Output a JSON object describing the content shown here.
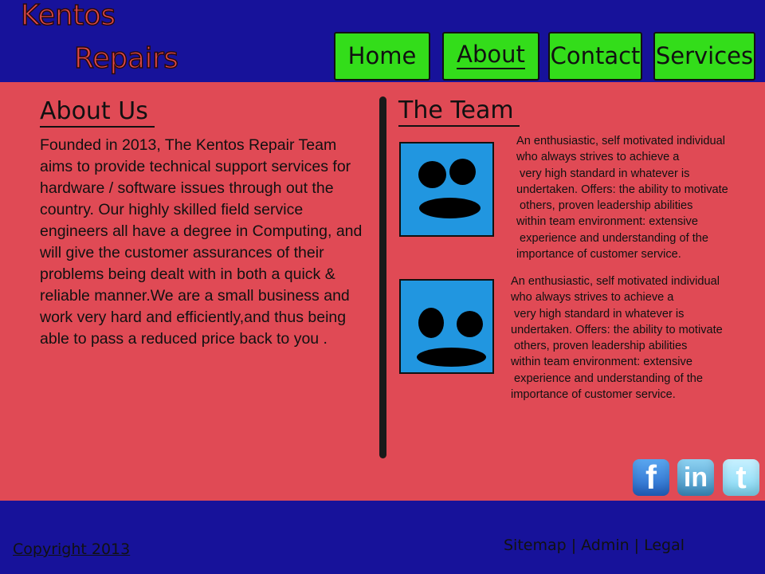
{
  "logo": {
    "line1": "Kentos",
    "line2": "Repairs"
  },
  "nav": [
    {
      "label": "Home",
      "active": false
    },
    {
      "label": "About",
      "active": true
    },
    {
      "label": "Contact",
      "active": false
    },
    {
      "label": "Services",
      "active": false
    }
  ],
  "about": {
    "title": "About Us",
    "text": "Founded in 2013, The Kentos Repair Team aims to provide technical support services for hardware / software issues through out the country. Our highly skilled field service engineers all have a degree in Computing, and will give the customer assurances of their problems being dealt with in both a quick & reliable manner.We are a small business and work very hard and efficiently,and thus being able to pass a reduced price back to you ."
  },
  "team": {
    "title": "The Team",
    "members": [
      {
        "bio": "An enthusiastic, self motivated individual\nwho always strives to achieve a\n very high standard in whatever is\nundertaken. Offers: the ability to motivate\n others, proven leadership abilities\nwithin team environment: extensive\n experience and understanding of the\nimportance of customer service."
      },
      {
        "bio": "An enthusiastic, self motivated individual\nwho always strives to achieve a\n very high standard in whatever is\nundertaken. Offers: the ability to motivate\n others, proven leadership abilities\nwithin team environment: extensive\n experience and understanding of the\nimportance of customer service."
      }
    ]
  },
  "social": [
    {
      "name": "facebook",
      "glyph": "f"
    },
    {
      "name": "linkedin",
      "glyph": "in"
    },
    {
      "name": "twitter",
      "glyph": "t"
    }
  ],
  "footer": {
    "copyright": "Copyright 2013",
    "links": [
      "Sitemap",
      "Admin",
      "Legal"
    ]
  },
  "colors": {
    "header_bg": "#17129a",
    "main_bg": "#e04a55",
    "nav_bg": "#33dd1a",
    "avatar_bg": "#2196e0",
    "logo": "#e14a4a"
  }
}
